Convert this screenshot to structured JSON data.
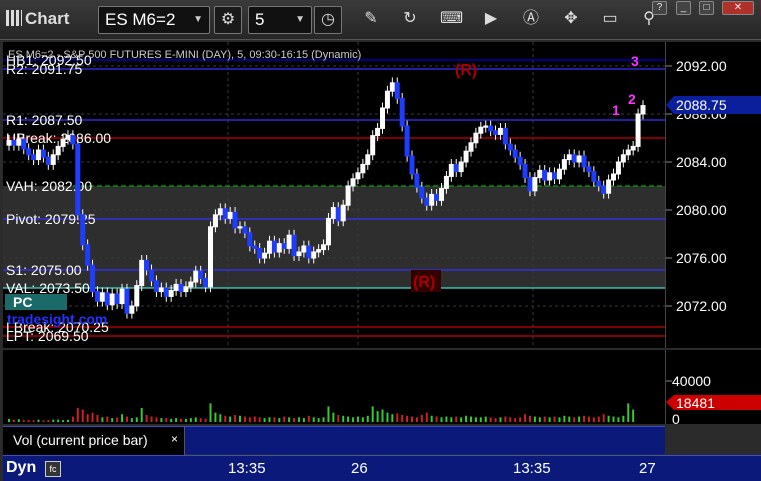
{
  "toolbar": {
    "app_title": "Chart",
    "symbol": "ES M6=2",
    "interval": "5"
  },
  "chart_title": "ES M6=2 - S&P 500 FUTURES E-MINI (DAY), 5, 09:30-16:15 (Dynamic)",
  "levels": [
    {
      "id": "hb1",
      "label": "HB1: 2092.50",
      "price": 2092.5,
      "color": "#0000cc"
    },
    {
      "id": "r2",
      "label": "R2: 2091.75",
      "price": 2091.75,
      "color": "#3333ff"
    },
    {
      "id": "r1",
      "label": "R1: 2087.50",
      "price": 2087.5,
      "color": "#3333ff"
    },
    {
      "id": "ubreak",
      "label": "UBreak: 2086.00",
      "price": 2086.0,
      "color": "#cc0000"
    },
    {
      "id": "vah",
      "label": "VAH: 2082.00",
      "price": 2082.0,
      "color": "#00aa00"
    },
    {
      "id": "pivot",
      "label": "Pivot: 2079.25",
      "price": 2079.25,
      "color": "#3333ff"
    },
    {
      "id": "s1",
      "label": "S1: 2075.00",
      "price": 2075.0,
      "color": "#3333ff"
    },
    {
      "id": "val",
      "label": "VAL: 2073.50",
      "price": 2073.5,
      "color": "#40e0d0"
    },
    {
      "id": "lbreak",
      "label": "LBreak: 2070.25",
      "price": 2070.25,
      "color": "#cc0000"
    },
    {
      "id": "lpt",
      "label": "LPT: 2069.50",
      "price": 2069.5,
      "color": "#cc0000"
    }
  ],
  "annotations": {
    "pc_label": "PC",
    "r_marker": "(R)",
    "counts": [
      "1",
      "2",
      "3"
    ],
    "watermark": "tradesight.com"
  },
  "price_axis": {
    "ticks": [
      "2092.00",
      "2088.00",
      "2084.00",
      "2080.00",
      "2076.00",
      "2072.00"
    ],
    "current_price": "2088.75"
  },
  "volume": {
    "ticks": [
      "40000",
      "0"
    ],
    "current": "18481",
    "legend_label": "Vol (current price bar)",
    "close_symbol": "×"
  },
  "time_axis": {
    "dyn_label": "Dyn",
    "labels": [
      "13:35",
      "26",
      "13:35",
      "27"
    ]
  },
  "chart_data": {
    "type": "candlestick",
    "title": "ES M6=2 - S&P 500 FUTURES E-MINI (DAY), 5, 09:30-16:15 (Dynamic)",
    "ylim": [
      2068.5,
      2094.0
    ],
    "y_ticks": [
      2072,
      2076,
      2080,
      2084,
      2088,
      2092
    ],
    "closes": [
      2085.8,
      2085.4,
      2085.9,
      2085.1,
      2084.6,
      2084.2,
      2085.0,
      2084.4,
      2083.8,
      2084.6,
      2085.3,
      2085.9,
      2086.2,
      2085.5,
      2079.6,
      2077.1,
      2075.4,
      2073.2,
      2072.4,
      2073.1,
      2072.1,
      2073.0,
      2072.2,
      2073.4,
      2071.4,
      2072.0,
      2073.7,
      2075.8,
      2075.0,
      2074.1,
      2073.2,
      2073.5,
      2072.8,
      2073.3,
      2073.8,
      2073.2,
      2073.6,
      2074.0,
      2074.9,
      2074.3,
      2073.6,
      2078.6,
      2079.6,
      2080.1,
      2079.3,
      2079.8,
      2078.5,
      2078.6,
      2078.1,
      2077.0,
      2076.8,
      2076.0,
      2076.4,
      2077.4,
      2076.5,
      2077.2,
      2076.8,
      2077.9,
      2076.2,
      2076.5,
      2077.0,
      2076.0,
      2076.5,
      2076.7,
      2077.1,
      2079.3,
      2080.2,
      2079.1,
      2080.4,
      2082.0,
      2082.6,
      2083.1,
      2083.8,
      2084.6,
      2086.2,
      2086.8,
      2088.5,
      2089.9,
      2090.6,
      2089.3,
      2087.0,
      2084.5,
      2083.0,
      2081.9,
      2081.0,
      2080.4,
      2081.3,
      2080.8,
      2081.8,
      2082.8,
      2083.8,
      2083.2,
      2084.0,
      2084.9,
      2085.6,
      2086.4,
      2086.9,
      2087.0,
      2086.6,
      2086.3,
      2086.8,
      2085.5,
      2085.0,
      2084.4,
      2083.8,
      2082.7,
      2081.6,
      2082.7,
      2083.3,
      2082.5,
      2083.1,
      2082.6,
      2083.4,
      2084.2,
      2084.6,
      2084.0,
      2084.5,
      2083.6,
      2083.2,
      2082.4,
      2082.0,
      2081.4,
      2082.5,
      2083.0,
      2084.0,
      2084.6,
      2085.0,
      2085.3,
      2088.0,
      2088.7
    ],
    "volumes": [
      2000,
      1500,
      1800,
      1200,
      1300,
      1100,
      1500,
      1000,
      1200,
      1500,
      1600,
      1200,
      1400,
      3500,
      9000,
      8000,
      5000,
      6000,
      4500,
      3000,
      3500,
      2500,
      3000,
      5000,
      3500,
      2500,
      3000,
      9000,
      4500,
      3500,
      3000,
      2500,
      2500,
      2000,
      2500,
      2000,
      2000,
      2500,
      3000,
      2500,
      2000,
      12000,
      6000,
      5000,
      4000,
      3500,
      4500,
      4000,
      3500,
      3000,
      3500,
      3000,
      2500,
      3000,
      3000,
      2500,
      3500,
      3000,
      2500,
      3000,
      2500,
      4000,
      3000,
      2500,
      3000,
      10000,
      6000,
      4500,
      4000,
      3500,
      3000,
      3500,
      3000,
      4000,
      10000,
      7000,
      8000,
      6000,
      5000,
      5500,
      4500,
      4000,
      3500,
      3000,
      4500,
      6000,
      4000,
      3500,
      3000,
      3500,
      3000,
      3500,
      3000,
      4000,
      3500,
      3000,
      3000,
      3500,
      3000,
      2500,
      3000,
      3500,
      3000,
      2500,
      3000,
      5000,
      4000,
      3500,
      3000,
      3500,
      3000,
      3500,
      3000,
      4000,
      3500,
      3000,
      3500,
      4000,
      3500,
      3000,
      3500,
      5000,
      4000,
      3500,
      3000,
      4000,
      12000,
      8000
    ]
  }
}
